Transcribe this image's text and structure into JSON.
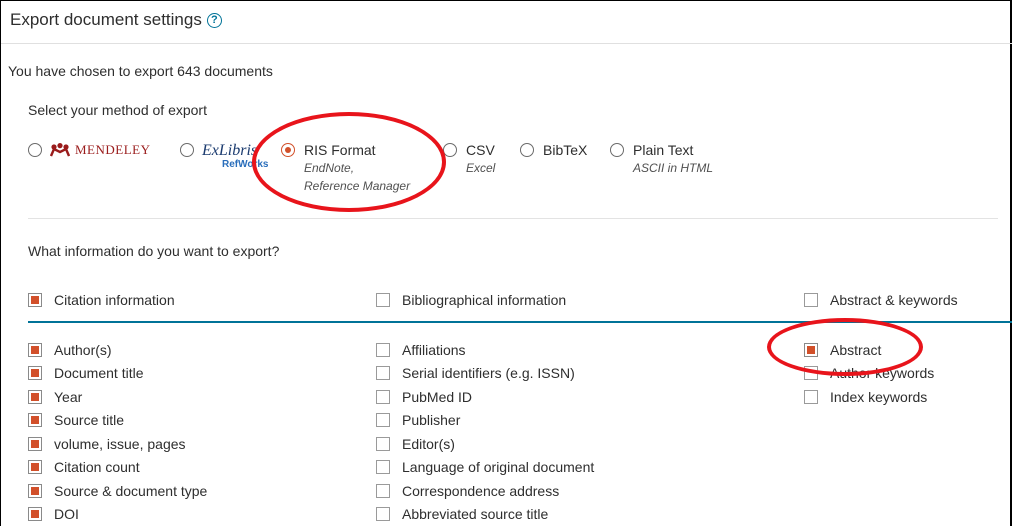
{
  "header": {
    "title": "Export document settings",
    "help_glyph": "?",
    "chosen_text": "You have chosen to export 643 documents"
  },
  "method": {
    "label": "Select your method of export",
    "options": [
      {
        "name": "mendeley",
        "label": "MENDELEY",
        "sub": "",
        "checked": false
      },
      {
        "name": "refworks",
        "label": "ExLibris",
        "sub": "RefWorks",
        "checked": false
      },
      {
        "name": "ris",
        "label": "RIS Format",
        "sub1": "EndNote,",
        "sub2": "Reference Manager",
        "checked": true
      },
      {
        "name": "csv",
        "label": "CSV",
        "sub": "Excel",
        "checked": false
      },
      {
        "name": "bibtex",
        "label": "BibTeX",
        "sub": "",
        "checked": false
      },
      {
        "name": "plaintext",
        "label": "Plain Text",
        "sub": "ASCII in HTML",
        "checked": false
      }
    ]
  },
  "info": {
    "label": "What information do you want to export?",
    "columns": [
      {
        "header": "Citation information",
        "checked": true,
        "items": [
          {
            "label": "Author(s)",
            "checked": true
          },
          {
            "label": "Document title",
            "checked": true
          },
          {
            "label": "Year",
            "checked": true
          },
          {
            "label": "Source title",
            "checked": true
          },
          {
            "label": "volume, issue, pages",
            "checked": true
          },
          {
            "label": "Citation count",
            "checked": true
          },
          {
            "label": "Source & document type",
            "checked": true
          },
          {
            "label": "DOI",
            "checked": true
          }
        ]
      },
      {
        "header": "Bibliographical information",
        "checked": false,
        "items": [
          {
            "label": "Affiliations",
            "checked": false
          },
          {
            "label": "Serial identifiers (e.g. ISSN)",
            "checked": false
          },
          {
            "label": "PubMed ID",
            "checked": false
          },
          {
            "label": "Publisher",
            "checked": false
          },
          {
            "label": "Editor(s)",
            "checked": false
          },
          {
            "label": "Language of original document",
            "checked": false
          },
          {
            "label": "Correspondence address",
            "checked": false
          },
          {
            "label": "Abbreviated source title",
            "checked": false
          }
        ]
      },
      {
        "header": "Abstract & keywords",
        "checked": false,
        "items": [
          {
            "label": "Abstract",
            "checked": true
          },
          {
            "label": "Author keywords",
            "checked": false
          },
          {
            "label": "Index keywords",
            "checked": false
          }
        ]
      }
    ]
  },
  "colors": {
    "accent": "#d2502a",
    "teal": "#007398",
    "annotation": "#e8141b"
  }
}
